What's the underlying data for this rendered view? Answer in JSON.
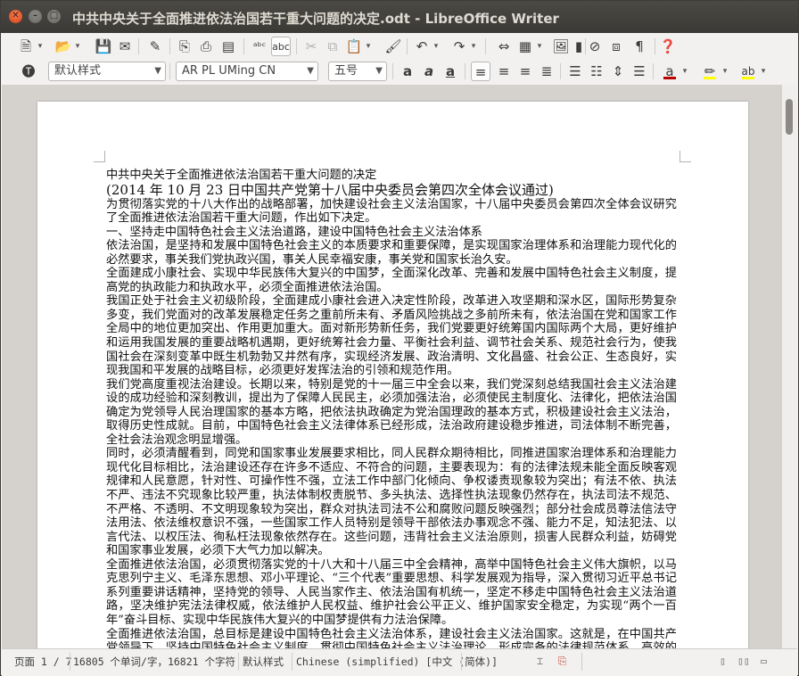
{
  "window": {
    "title": "中共中央关于全面推进依法治国若干重大问题的决定.odt - LibreOffice Writer",
    "close_glyph": "✕",
    "minimize_glyph": "–",
    "maximize_glyph": "□"
  },
  "toolbar_standard": {
    "icons": [
      "new-document",
      "open",
      "save",
      "email",
      "edit-mode",
      "export-pdf",
      "print",
      "print-preview",
      "spelling",
      "autospellcheck",
      "cut",
      "copy",
      "paste",
      "clone-formatting",
      "undo",
      "redo",
      "find-replace",
      "insert-table",
      "insert-image",
      "insert-chart",
      "insert-field",
      "navigator",
      "formatting-marks",
      "help"
    ]
  },
  "toolbar_formatting": {
    "paragraph_style": "默认样式",
    "font_name": "AR PL UMing CN",
    "font_size": "五号",
    "font_color": "#c00000",
    "highlight_color": "#ffff00",
    "char_bg_color": "#ffff00"
  },
  "document": {
    "paragraphs": [
      "中共中央关于全面推进依法治国若干重大问题的决定",
      "(2014 年 10 月 23 日中国共产党第十八届中央委员会第四次全体会议通过)",
      "为贯彻落实党的十八大作出的战略部署，加快建设社会主义法治国家，十八届中央委员会第四次全体会议研究了全面推进依法治国若干重大问题，作出如下决定。",
      "一、坚持走中国特色社会主义法治道路，建设中国特色社会主义法治体系",
      "依法治国，是坚持和发展中国特色社会主义的本质要求和重要保障，是实现国家治理体系和治理能力现代化的必然要求，事关我们党执政兴国，事关人民幸福安康，事关党和国家长治久安。",
      "全面建成小康社会、实现中华民族伟大复兴的中国梦，全面深化改革、完善和发展中国特色社会主义制度，提高党的执政能力和执政水平，必须全面推进依法治国。",
      "我国正处于社会主义初级阶段，全面建成小康社会进入决定性阶段，改革进入攻坚期和深水区，国际形势复杂多变，我们党面对的改革发展稳定任务之重前所未有、矛盾风险挑战之多前所未有，依法治国在党和国家工作全局中的地位更加突出、作用更加重大。面对新形势新任务，我们党要更好统筹国内国际两个大局，更好维护和运用我国发展的重要战略机遇期，更好统筹社会力量、平衡社会利益、调节社会关系、规范社会行为，使我国社会在深刻变革中既生机勃勃又井然有序，实现经济发展、政治清明、文化昌盛、社会公正、生态良好，实现我国和平发展的战略目标，必须更好发挥法治的引领和规范作用。",
      "我们党高度重视法治建设。长期以来，特别是党的十一届三中全会以来，我们党深刻总结我国社会主义法治建设的成功经验和深刻教训，提出为了保障人民民主，必须加强法治，必须使民主制度化、法律化，把依法治国确定为党领导人民治理国家的基本方略，把依法执政确定为党治国理政的基本方式，积极建设社会主义法治，取得历史性成就。目前，中国特色社会主义法律体系已经形成，法治政府建设稳步推进，司法体制不断完善，全社会法治观念明显增强。",
      "同时，必须清醒看到，同党和国家事业发展要求相比，同人民群众期待相比，同推进国家治理体系和治理能力现代化目标相比，法治建设还存在许多不适应、不符合的问题，主要表现为：有的法律法规未能全面反映客观规律和人民意愿，针对性、可操作性不强，立法工作中部门化倾向、争权诿责现象较为突出；有法不依、执法不严、违法不究现象比较严重，执法体制权责脱节、多头执法、选择性执法现象仍然存在，执法司法不规范、不严格、不透明、不文明现象较为突出，群众对执法司法不公和腐败问题反映强烈；部分社会成员尊法信法守法用法、依法维权意识不强，一些国家工作人员特别是领导干部依法办事观念不强、能力不足，知法犯法、以言代法、以权压法、徇私枉法现象依然存在。这些问题，违背社会主义法治原则，损害人民群众利益，妨碍党和国家事业发展，必须下大气力加以解决。",
      "全面推进依法治国，必须贯彻落实党的十八大和十八届三中全会精神，高举中国特色社会主义伟大旗帜，以马克思列宁主义、毛泽东思想、邓小平理论、“三个代表”重要思想、科学发展观为指导，深入贯彻习近平总书记系列重要讲话精神，坚持党的领导、人民当家作主、依法治国有机统一，坚定不移走中国特色社会主义法治道路，坚决维护宪法法律权威，依法维护人民权益、维护社会公平正义、维护国家安全稳定，为实现“两个一百年”奋斗目标、实现中华民族伟大复兴的中国梦提供有力法治保障。",
      "全面推进依法治国，总目标是建设中国特色社会主义法治体系，建设社会主义法治国家。这就是，在中国共产党领导下，坚持中国特色社会主义制度，贯彻中国特色社会主义法治理论，形成完备的法律规范体系、高效的法治实施体系、严密的法治监督体系、有力的法治保障体系，形成完善的党内法规体系，"
    ]
  },
  "status": {
    "page": "页面 1 / 7",
    "word_count": "16805 个单词/字，16821 个字符",
    "page_style": "默认样式",
    "language": "Chinese (simplified) [中文 (简体)]"
  }
}
